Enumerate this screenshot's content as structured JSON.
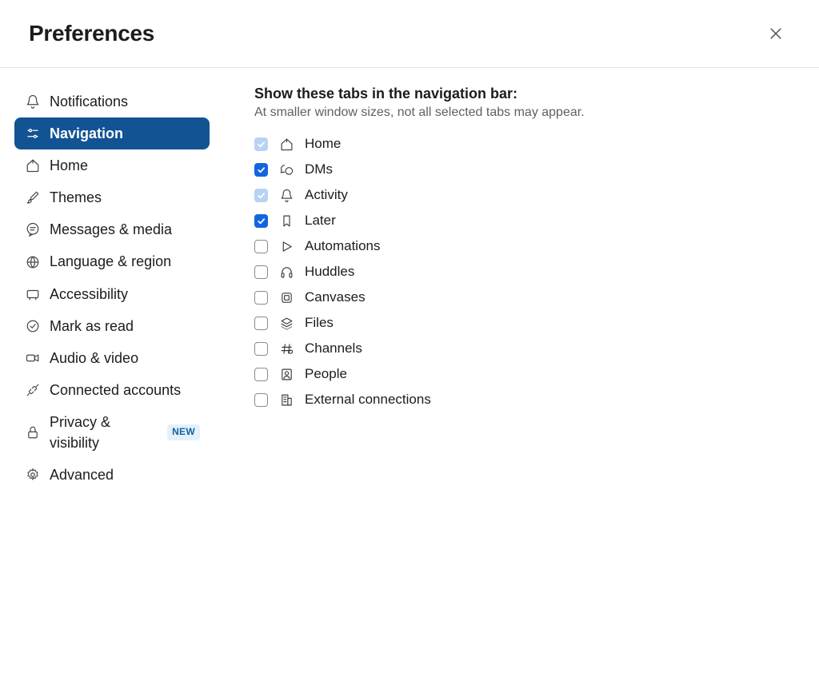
{
  "header": {
    "title": "Preferences"
  },
  "sidebar": {
    "items": [
      {
        "label": "Notifications",
        "icon": "bell-icon",
        "active": false
      },
      {
        "label": "Navigation",
        "icon": "sliders-icon",
        "active": true
      },
      {
        "label": "Home",
        "icon": "home-icon",
        "active": false
      },
      {
        "label": "Themes",
        "icon": "brush-icon",
        "active": false
      },
      {
        "label": "Messages & media",
        "icon": "chat-icon",
        "active": false
      },
      {
        "label": "Language & region",
        "icon": "globe-icon",
        "active": false
      },
      {
        "label": "Accessibility",
        "icon": "accessibility-icon",
        "active": false
      },
      {
        "label": "Mark as read",
        "icon": "check-circle-icon",
        "active": false
      },
      {
        "label": "Audio & video",
        "icon": "video-icon",
        "active": false
      },
      {
        "label": "Connected accounts",
        "icon": "plug-icon",
        "active": false
      },
      {
        "label": "Privacy & visibility",
        "icon": "lock-icon",
        "active": false,
        "badge": "NEW"
      },
      {
        "label": "Advanced",
        "icon": "gear-icon",
        "active": false
      }
    ]
  },
  "content": {
    "section_title": "Show these tabs in the navigation bar:",
    "section_subtitle": "At smaller window sizes, not all selected tabs may appear.",
    "tabs": [
      {
        "label": "Home",
        "icon": "home-icon",
        "state": "checked-disabled"
      },
      {
        "label": "DMs",
        "icon": "dms-icon",
        "state": "checked"
      },
      {
        "label": "Activity",
        "icon": "bell-icon",
        "state": "checked-disabled"
      },
      {
        "label": "Later",
        "icon": "bookmark-icon",
        "state": "checked"
      },
      {
        "label": "Automations",
        "icon": "play-icon",
        "state": "unchecked"
      },
      {
        "label": "Huddles",
        "icon": "headphones-icon",
        "state": "unchecked"
      },
      {
        "label": "Canvases",
        "icon": "canvas-icon",
        "state": "unchecked"
      },
      {
        "label": "Files",
        "icon": "files-icon",
        "state": "unchecked"
      },
      {
        "label": "Channels",
        "icon": "channels-icon",
        "state": "unchecked"
      },
      {
        "label": "People",
        "icon": "people-icon",
        "state": "unchecked"
      },
      {
        "label": "External connections",
        "icon": "building-icon",
        "state": "unchecked"
      }
    ]
  }
}
